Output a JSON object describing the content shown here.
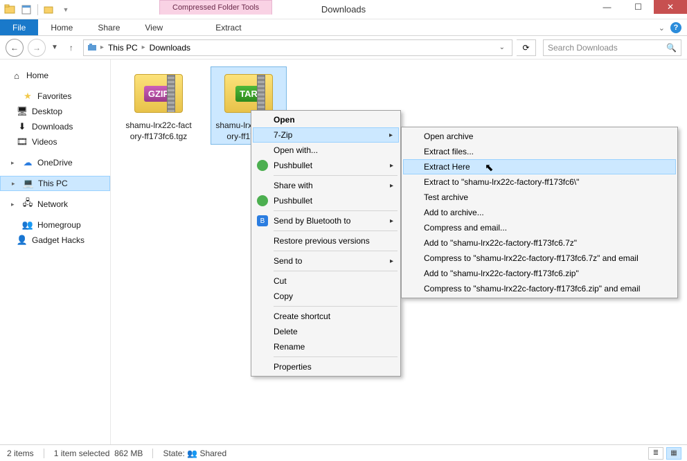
{
  "title": "Downloads",
  "contextual_tab": "Compressed Folder Tools",
  "ribbon": {
    "file": "File",
    "home": "Home",
    "share": "Share",
    "view": "View",
    "extract": "Extract"
  },
  "address": {
    "seg1": "This PC",
    "seg2": "Downloads"
  },
  "search_placeholder": "Search Downloads",
  "sidebar": {
    "home": "Home",
    "favorites": "Favorites",
    "desktop": "Desktop",
    "downloads": "Downloads",
    "videos": "Videos",
    "onedrive": "OneDrive",
    "thispc": "This PC",
    "network": "Network",
    "homegroup": "Homegroup",
    "gadgethacks": "Gadget Hacks"
  },
  "files": [
    {
      "label": "shamu-lrx22c-factory-ff173fc6.tgz",
      "badge": "GZIP"
    },
    {
      "label": "shamu-lrx22c-factory-ff173fc6",
      "badge": "TAR"
    }
  ],
  "context_main": {
    "open": "Open",
    "sevenzip": "7-Zip",
    "openwith": "Open with...",
    "pushbullet1": "Pushbullet",
    "sharewith": "Share with",
    "pushbullet2": "Pushbullet",
    "sendbt": "Send by Bluetooth to",
    "restore": "Restore previous versions",
    "sendto": "Send to",
    "cut": "Cut",
    "copy": "Copy",
    "shortcut": "Create shortcut",
    "delete": "Delete",
    "rename": "Rename",
    "properties": "Properties"
  },
  "context_7z": {
    "openarchive": "Open archive",
    "extractfiles": "Extract files...",
    "extracthere": "Extract Here",
    "extractto": "Extract to \"shamu-lrx22c-factory-ff173fc6\\\"",
    "test": "Test archive",
    "addto": "Add to archive...",
    "compressemail": "Compress and email...",
    "add7z": "Add to \"shamu-lrx22c-factory-ff173fc6.7z\"",
    "comp7zemail": "Compress to \"shamu-lrx22c-factory-ff173fc6.7z\" and email",
    "addzip": "Add to \"shamu-lrx22c-factory-ff173fc6.zip\"",
    "compzipemail": "Compress to \"shamu-lrx22c-factory-ff173fc6.zip\" and email"
  },
  "status": {
    "items": "2 items",
    "selected": "1 item selected",
    "size": "862 MB",
    "state_label": "State:",
    "state_value": "Shared"
  }
}
